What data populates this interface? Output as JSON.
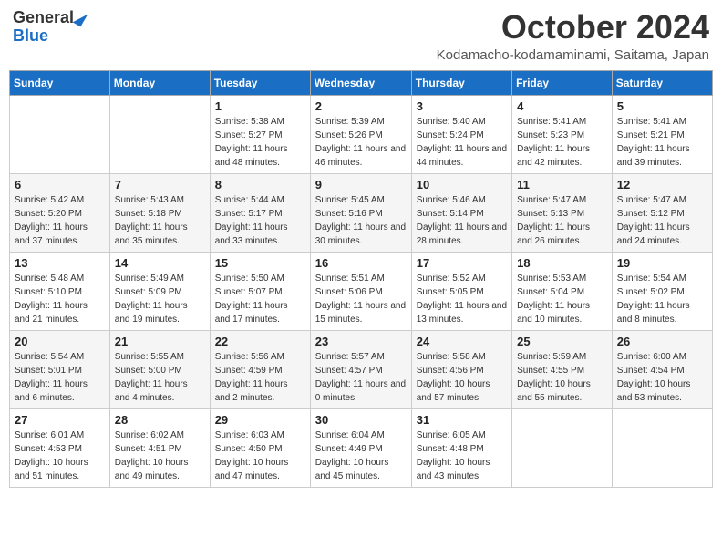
{
  "logo": {
    "general": "General",
    "blue": "Blue"
  },
  "title": "October 2024",
  "subtitle": "Kodamacho-kodamaminami, Saitama, Japan",
  "headers": [
    "Sunday",
    "Monday",
    "Tuesday",
    "Wednesday",
    "Thursday",
    "Friday",
    "Saturday"
  ],
  "weeks": [
    [
      {
        "day": "",
        "info": ""
      },
      {
        "day": "",
        "info": ""
      },
      {
        "day": "1",
        "info": "Sunrise: 5:38 AM\nSunset: 5:27 PM\nDaylight: 11 hours and 48 minutes."
      },
      {
        "day": "2",
        "info": "Sunrise: 5:39 AM\nSunset: 5:26 PM\nDaylight: 11 hours and 46 minutes."
      },
      {
        "day": "3",
        "info": "Sunrise: 5:40 AM\nSunset: 5:24 PM\nDaylight: 11 hours and 44 minutes."
      },
      {
        "day": "4",
        "info": "Sunrise: 5:41 AM\nSunset: 5:23 PM\nDaylight: 11 hours and 42 minutes."
      },
      {
        "day": "5",
        "info": "Sunrise: 5:41 AM\nSunset: 5:21 PM\nDaylight: 11 hours and 39 minutes."
      }
    ],
    [
      {
        "day": "6",
        "info": "Sunrise: 5:42 AM\nSunset: 5:20 PM\nDaylight: 11 hours and 37 minutes."
      },
      {
        "day": "7",
        "info": "Sunrise: 5:43 AM\nSunset: 5:18 PM\nDaylight: 11 hours and 35 minutes."
      },
      {
        "day": "8",
        "info": "Sunrise: 5:44 AM\nSunset: 5:17 PM\nDaylight: 11 hours and 33 minutes."
      },
      {
        "day": "9",
        "info": "Sunrise: 5:45 AM\nSunset: 5:16 PM\nDaylight: 11 hours and 30 minutes."
      },
      {
        "day": "10",
        "info": "Sunrise: 5:46 AM\nSunset: 5:14 PM\nDaylight: 11 hours and 28 minutes."
      },
      {
        "day": "11",
        "info": "Sunrise: 5:47 AM\nSunset: 5:13 PM\nDaylight: 11 hours and 26 minutes."
      },
      {
        "day": "12",
        "info": "Sunrise: 5:47 AM\nSunset: 5:12 PM\nDaylight: 11 hours and 24 minutes."
      }
    ],
    [
      {
        "day": "13",
        "info": "Sunrise: 5:48 AM\nSunset: 5:10 PM\nDaylight: 11 hours and 21 minutes."
      },
      {
        "day": "14",
        "info": "Sunrise: 5:49 AM\nSunset: 5:09 PM\nDaylight: 11 hours and 19 minutes."
      },
      {
        "day": "15",
        "info": "Sunrise: 5:50 AM\nSunset: 5:07 PM\nDaylight: 11 hours and 17 minutes."
      },
      {
        "day": "16",
        "info": "Sunrise: 5:51 AM\nSunset: 5:06 PM\nDaylight: 11 hours and 15 minutes."
      },
      {
        "day": "17",
        "info": "Sunrise: 5:52 AM\nSunset: 5:05 PM\nDaylight: 11 hours and 13 minutes."
      },
      {
        "day": "18",
        "info": "Sunrise: 5:53 AM\nSunset: 5:04 PM\nDaylight: 11 hours and 10 minutes."
      },
      {
        "day": "19",
        "info": "Sunrise: 5:54 AM\nSunset: 5:02 PM\nDaylight: 11 hours and 8 minutes."
      }
    ],
    [
      {
        "day": "20",
        "info": "Sunrise: 5:54 AM\nSunset: 5:01 PM\nDaylight: 11 hours and 6 minutes."
      },
      {
        "day": "21",
        "info": "Sunrise: 5:55 AM\nSunset: 5:00 PM\nDaylight: 11 hours and 4 minutes."
      },
      {
        "day": "22",
        "info": "Sunrise: 5:56 AM\nSunset: 4:59 PM\nDaylight: 11 hours and 2 minutes."
      },
      {
        "day": "23",
        "info": "Sunrise: 5:57 AM\nSunset: 4:57 PM\nDaylight: 11 hours and 0 minutes."
      },
      {
        "day": "24",
        "info": "Sunrise: 5:58 AM\nSunset: 4:56 PM\nDaylight: 10 hours and 57 minutes."
      },
      {
        "day": "25",
        "info": "Sunrise: 5:59 AM\nSunset: 4:55 PM\nDaylight: 10 hours and 55 minutes."
      },
      {
        "day": "26",
        "info": "Sunrise: 6:00 AM\nSunset: 4:54 PM\nDaylight: 10 hours and 53 minutes."
      }
    ],
    [
      {
        "day": "27",
        "info": "Sunrise: 6:01 AM\nSunset: 4:53 PM\nDaylight: 10 hours and 51 minutes."
      },
      {
        "day": "28",
        "info": "Sunrise: 6:02 AM\nSunset: 4:51 PM\nDaylight: 10 hours and 49 minutes."
      },
      {
        "day": "29",
        "info": "Sunrise: 6:03 AM\nSunset: 4:50 PM\nDaylight: 10 hours and 47 minutes."
      },
      {
        "day": "30",
        "info": "Sunrise: 6:04 AM\nSunset: 4:49 PM\nDaylight: 10 hours and 45 minutes."
      },
      {
        "day": "31",
        "info": "Sunrise: 6:05 AM\nSunset: 4:48 PM\nDaylight: 10 hours and 43 minutes."
      },
      {
        "day": "",
        "info": ""
      },
      {
        "day": "",
        "info": ""
      }
    ]
  ]
}
